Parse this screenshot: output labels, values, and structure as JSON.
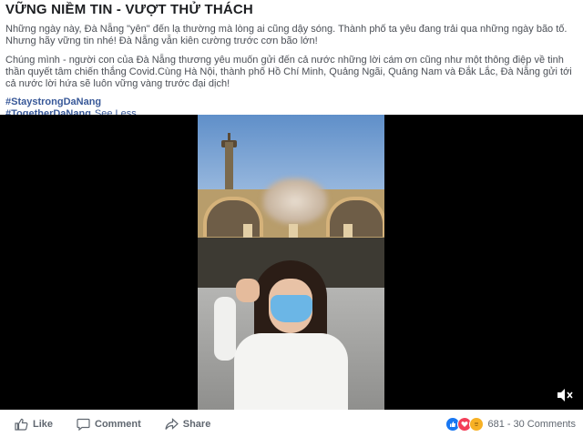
{
  "post": {
    "title": "VỮNG NIỀM TIN - VƯỢT THỬ THÁCH",
    "paragraph1": "Những ngày này, Đà Nẵng \"yên\" đến lạ thường mà lòng ai cũng dậy sóng. Thành phố ta yêu đang trải qua những ngày bão tố. Nhưng hãy vững tin nhé! Đà Nẵng vẫn kiên cường trước cơn bão lớn!",
    "paragraph2": "Chúng mình - người con của Đà Nẵng thương yêu muốn gửi đến cả nước những lời cám ơn cũng như một thông điệp về tinh thần quyết tâm chiến thắng Covid.Cùng Hà Nội, thành phố Hồ Chí Minh, Quảng Ngãi, Quảng Nam và Đắk Lắc, Đà Nẵng gửi tới cả nước lời hứa sẽ luôn vững vàng trước đại dịch!",
    "hashtags": [
      "#StaystrongDaNang",
      "#TogetherDaNang"
    ],
    "see_less": "See Less"
  },
  "video": {
    "volume_icon": "volume-muted-icon"
  },
  "actions": {
    "like": "Like",
    "comment": "Comment",
    "share": "Share"
  },
  "reactions": {
    "icons": [
      "like-reaction-icon",
      "love-reaction-icon",
      "care-reaction-icon"
    ],
    "count": "681",
    "separator": "-",
    "comments": "30 Comments"
  },
  "colors": {
    "link": "#385898",
    "text": "#1c1e21",
    "muted": "#606770"
  }
}
